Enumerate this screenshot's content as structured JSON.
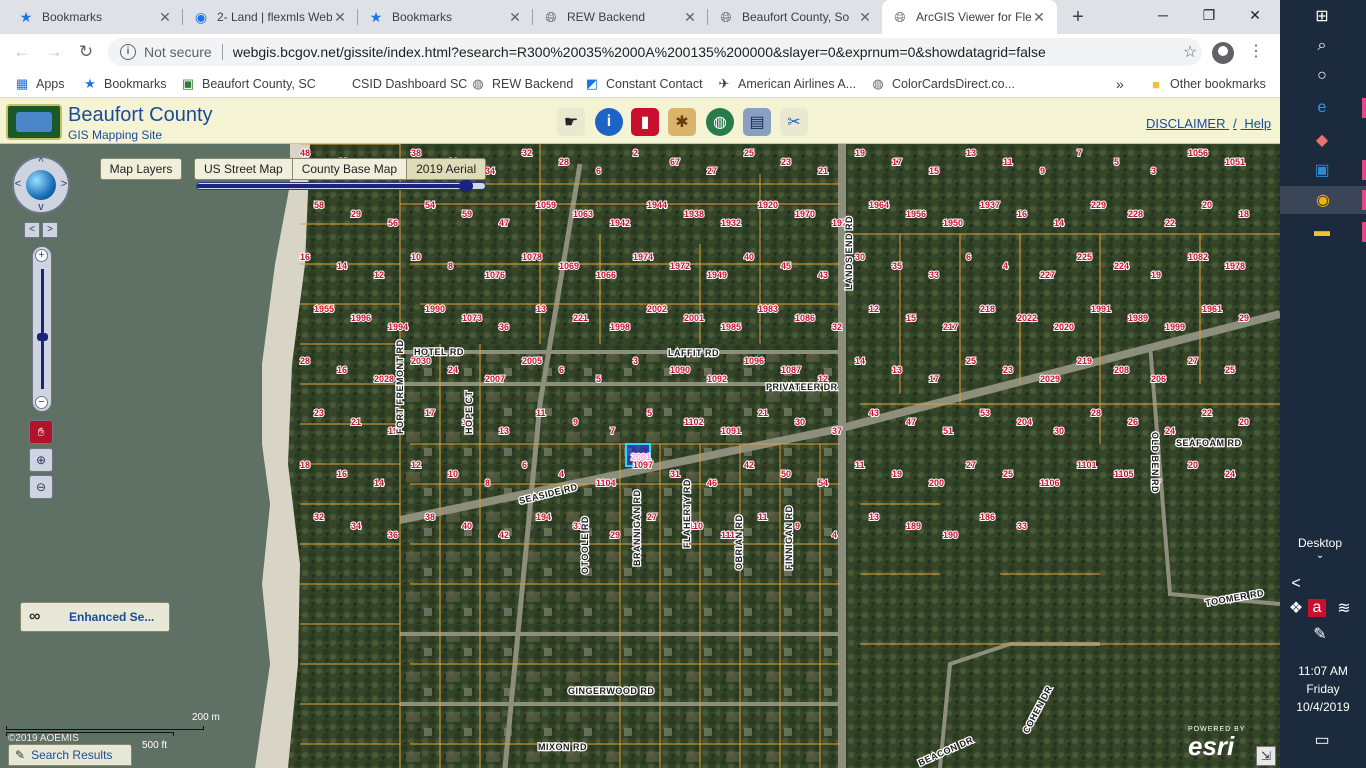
{
  "tabs": [
    {
      "title": "Bookmarks",
      "icon": "star-icon"
    },
    {
      "title": "2- Land | flexmls Web",
      "icon": "flexmls-icon"
    },
    {
      "title": "Bookmarks",
      "icon": "star-icon"
    },
    {
      "title": "REW Backend",
      "icon": "globe-icon"
    },
    {
      "title": "Beaufort County, So",
      "icon": "globe-icon"
    },
    {
      "title": "ArcGIS Viewer for Fle",
      "icon": "globe-icon"
    }
  ],
  "address": {
    "not_secure": "Not secure",
    "url": "webgis.bcgov.net/gissite/index.html?esearch=R300%20035%2000A%200135%200000&slayer=0&exprnum=0&showdatagrid=false"
  },
  "bookmarks": [
    {
      "label": "Apps"
    },
    {
      "label": "Bookmarks"
    },
    {
      "label": "Beaufort County, SC"
    },
    {
      "label": "CSID Dashboard SC"
    },
    {
      "label": "REW Backend"
    },
    {
      "label": "Constant Contact"
    },
    {
      "label": "American Airlines A..."
    },
    {
      "label": "ColorCardsDirect.co..."
    }
  ],
  "bookmarks_overflow": "»",
  "other_bookmarks": "Other bookmarks",
  "header": {
    "title": "Beaufort County",
    "subtitle": "GIS Mapping Site",
    "disclaimer": "DISCLAIMER",
    "separator": "/",
    "help": "Help"
  },
  "map_controls": {
    "map_layers": "Map Layers",
    "basemaps": [
      "US Street Map",
      "County Base Map",
      "2019 Aerial"
    ],
    "opacity": 0.96,
    "zoom_level": 0.43,
    "enhanced_search": "Enhanced Se...",
    "search_results": "Search Results",
    "scale_metric": "200 m",
    "scale_imperial": "500 ft",
    "copyright": "©2019 AOEMIS",
    "powered_by": "POWERED BY",
    "esri": "esri"
  },
  "roads": [
    {
      "name": "HOTEL RD"
    },
    {
      "name": "LAFFIT RD"
    },
    {
      "name": "PRIVATEER DR"
    },
    {
      "name": "LANDS END RD"
    },
    {
      "name": "FORT FREMONT RD"
    },
    {
      "name": "HOPE CT"
    },
    {
      "name": "SEASIDE RD"
    },
    {
      "name": "OTOOLE RD"
    },
    {
      "name": "BRANNIGAN RD"
    },
    {
      "name": "FLAHERTY RD"
    },
    {
      "name": "OBRIAN RD"
    },
    {
      "name": "FINNIGAN RD"
    },
    {
      "name": "GINGERWOOD RD"
    },
    {
      "name": "MIXON RD"
    },
    {
      "name": "SEAFOAM RD"
    },
    {
      "name": "OLD BEN RD"
    },
    {
      "name": "TOOMER RD"
    },
    {
      "name": "COHEN DR"
    },
    {
      "name": "BEACON DR"
    }
  ],
  "parcels": [
    "48",
    "44",
    "40",
    "38",
    "36",
    "34",
    "32",
    "28",
    "6",
    "2",
    "67",
    "27",
    "25",
    "23",
    "21",
    "19",
    "17",
    "15",
    "13",
    "11",
    "9",
    "7",
    "5",
    "3",
    "1056",
    "1051",
    "58",
    "29",
    "56",
    "54",
    "59",
    "47",
    "1059",
    "1063",
    "1942",
    "1944",
    "1938",
    "1932",
    "1920",
    "1970",
    "1976",
    "1964",
    "1956",
    "1950",
    "1937",
    "16",
    "14",
    "229",
    "228",
    "22",
    "20",
    "18",
    "16",
    "14",
    "12",
    "10",
    "8",
    "1076",
    "1078",
    "1069",
    "1066",
    "1974",
    "1972",
    "1949",
    "40",
    "45",
    "43",
    "30",
    "35",
    "33",
    "6",
    "4",
    "227",
    "225",
    "224",
    "19",
    "1082",
    "1978",
    "1955",
    "1996",
    "1994",
    "1990",
    "1073",
    "36",
    "13",
    "221",
    "1998",
    "2002",
    "2001",
    "1985",
    "1983",
    "1086",
    "32",
    "12",
    "15",
    "217",
    "218",
    "2022",
    "2020",
    "1991",
    "1989",
    "1999",
    "1961",
    "29",
    "28",
    "16",
    "2028",
    "2030",
    "24",
    "2007",
    "2005",
    "6",
    "5",
    "3",
    "1090",
    "1092",
    "1096",
    "1087",
    "12",
    "14",
    "13",
    "17",
    "25",
    "23",
    "2029",
    "219",
    "208",
    "206",
    "27",
    "25",
    "23",
    "21",
    "19",
    "17",
    "15",
    "13",
    "11",
    "9",
    "7",
    "5",
    "1102",
    "1091",
    "21",
    "30",
    "37",
    "43",
    "47",
    "51",
    "53",
    "204",
    "30",
    "28",
    "26",
    "24",
    "22",
    "20",
    "18",
    "16",
    "14",
    "12",
    "10",
    "8",
    "6",
    "4",
    "1104",
    "1097",
    "31",
    "46",
    "42",
    "50",
    "54",
    "11",
    "19",
    "200",
    "27",
    "25",
    "1106",
    "1101",
    "1105",
    "17",
    "20",
    "24",
    "32",
    "34",
    "36",
    "38",
    "40",
    "42",
    "194",
    "31",
    "29",
    "27",
    "1110",
    "1114",
    "11",
    "9",
    "4",
    "13",
    "189",
    "190",
    "186",
    "33"
  ],
  "selected_parcel": "2001",
  "taskbar": {
    "desktop": "Desktop",
    "time": "11:07 AM",
    "day": "Friday",
    "date": "10/4/2019"
  }
}
